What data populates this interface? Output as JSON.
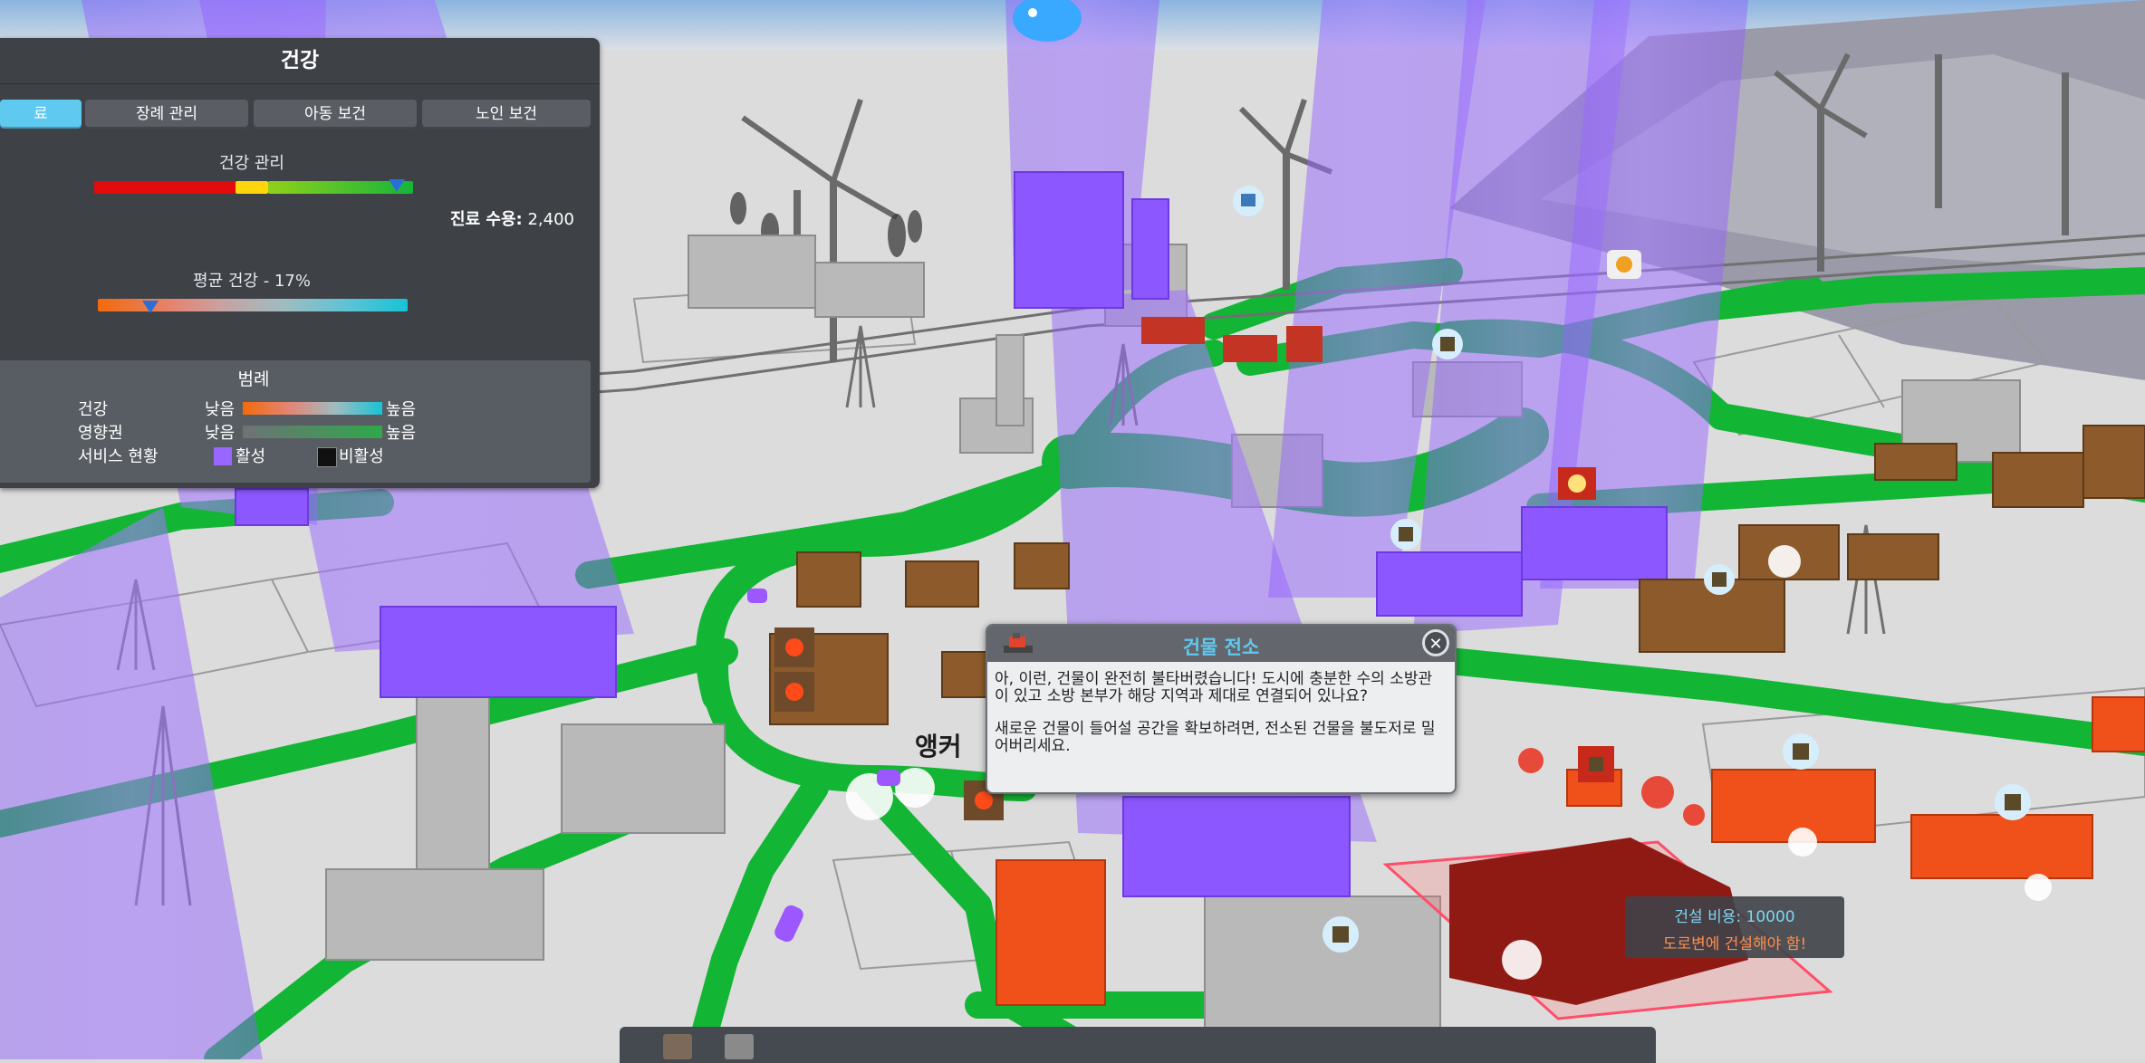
{
  "panel": {
    "title": "건강",
    "tabs": [
      {
        "label": "료",
        "active": true
      },
      {
        "label": "장례 관리",
        "active": false
      },
      {
        "label": "아동 보건",
        "active": false
      },
      {
        "label": "노인 보건",
        "active": false
      }
    ],
    "healthcare_label": "건강 관리",
    "healthcare_level": 0.95,
    "clinic_label": "진료 수용:",
    "clinic_value": "2,400",
    "avg_health_label": "평균 건강 - 17%",
    "avg_health_percent": 17,
    "legend": {
      "title": "범례",
      "health_label": "건강",
      "influence_label": "영향권",
      "service_label": "서비스 현황",
      "low": "낮음",
      "high": "높음",
      "active": "활성",
      "inactive": "비활성"
    }
  },
  "dialog": {
    "title": "건물 전소",
    "paragraph1": "아, 이런, 건물이 완전히 불타버렸습니다! 도시에 충분한 수의 소방관이 있고 소방 본부가 해당 지역과 제대로 연결되어 있나요?",
    "paragraph2": "새로운 건물이 들어설 공간을 확보하려면, 전소된 건물을 불도저로 밀어버리세요."
  },
  "build_cost": {
    "cost_label": "건설 비용: 10000",
    "warning": "도로변에 건설해야 함!"
  },
  "map_label": "앵커",
  "colors": {
    "health_beam": "#9966ff",
    "road": "#13b534",
    "burned": "#8d5a2b",
    "accent": "#5fc9f0",
    "warning": "#ff8e4d"
  }
}
